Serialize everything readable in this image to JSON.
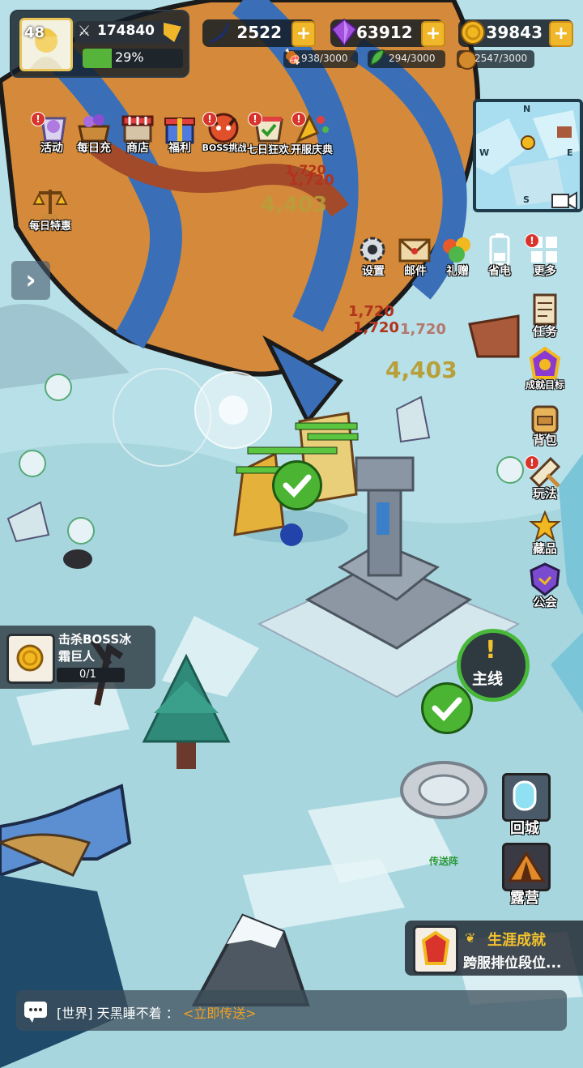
{
  "player": {
    "level": "48",
    "power": "174840",
    "xp_percent": "29%",
    "xp_fraction": 0.29
  },
  "resources": [
    {
      "name": "moon-shard",
      "value": "2522"
    },
    {
      "name": "purple-gem",
      "value": "63912"
    },
    {
      "name": "gold-coin",
      "value": "39843"
    }
  ],
  "sub_resources": [
    {
      "name": "meat",
      "value": "938/3000"
    },
    {
      "name": "wood",
      "value": "294/3000"
    },
    {
      "name": "ore",
      "value": "2547/3000"
    }
  ],
  "top_menu": [
    {
      "label": "活动",
      "icon": "event-icon",
      "badge": "!"
    },
    {
      "label": "每日充",
      "icon": "daily-recharge-icon"
    },
    {
      "label": "商店",
      "icon": "shop-icon"
    },
    {
      "label": "福利",
      "icon": "gift-icon"
    },
    {
      "label": "BOSS挑战",
      "icon": "boss-icon",
      "badge": "!"
    },
    {
      "label": "七日狂欢",
      "icon": "seven-day-icon",
      "badge": "!"
    },
    {
      "label": "开服庆典",
      "icon": "celebration-icon",
      "badge": "!"
    }
  ],
  "daily_deal": {
    "label": "每日特惠",
    "icon": "scale-icon"
  },
  "minimap": {
    "n": "N",
    "s": "S",
    "e": "E",
    "w": "W"
  },
  "settings_row": [
    {
      "label": "设置",
      "icon": "gear-icon"
    },
    {
      "label": "邮件",
      "icon": "mail-icon"
    },
    {
      "label": "礼赠",
      "icon": "gift-box-icon"
    },
    {
      "label": "省电",
      "icon": "battery-icon"
    },
    {
      "label": "更多",
      "icon": "more-grid-icon",
      "badge": "!"
    }
  ],
  "side_menu": [
    {
      "label": "任务",
      "icon": "scroll-icon"
    },
    {
      "label": "成就目标",
      "icon": "achievement-icon"
    },
    {
      "label": "背包",
      "icon": "backpack-icon"
    },
    {
      "label": "玩法",
      "icon": "gameplay-icon",
      "badge": "!"
    },
    {
      "label": "藏品",
      "icon": "collection-icon"
    },
    {
      "label": "公会",
      "icon": "guild-icon"
    }
  ],
  "damage_numbers": [
    {
      "text": "1,720",
      "color": "#b3331c"
    },
    {
      "text": "1,720",
      "color": "#b3331c"
    },
    {
      "text": "4,403",
      "color": "#b7a03a"
    },
    {
      "text": "1,720",
      "color": "#b3331c"
    },
    {
      "text": "1,720",
      "color": "#b3331c"
    },
    {
      "text": "1,720",
      "color": "#b3331c"
    },
    {
      "text": "4,403",
      "color": "#b7a03a"
    }
  ],
  "quest": {
    "title_line1": "击杀BOSS冰",
    "title_line2": "霜巨人",
    "progress": "0/1"
  },
  "main_quest": {
    "label": "主线",
    "icon": "exclamation-icon"
  },
  "teleport": {
    "label": "传送阵"
  },
  "return_city": {
    "label": "回城",
    "icon": "portal-icon"
  },
  "camp": {
    "label": "露营",
    "icon": "tent-icon"
  },
  "career": {
    "title": "生涯成就",
    "subtitle": "跨服排位段位..."
  },
  "chat": {
    "channel": "[世界]",
    "sender": "天黑睡不着",
    "separator": "：",
    "link": "<立即传送>"
  },
  "colors": {
    "accent_gold": "#f1b72a",
    "xp_green": "#56b43a",
    "badge_red": "#d9342b",
    "link_orange": "#f0a020"
  }
}
